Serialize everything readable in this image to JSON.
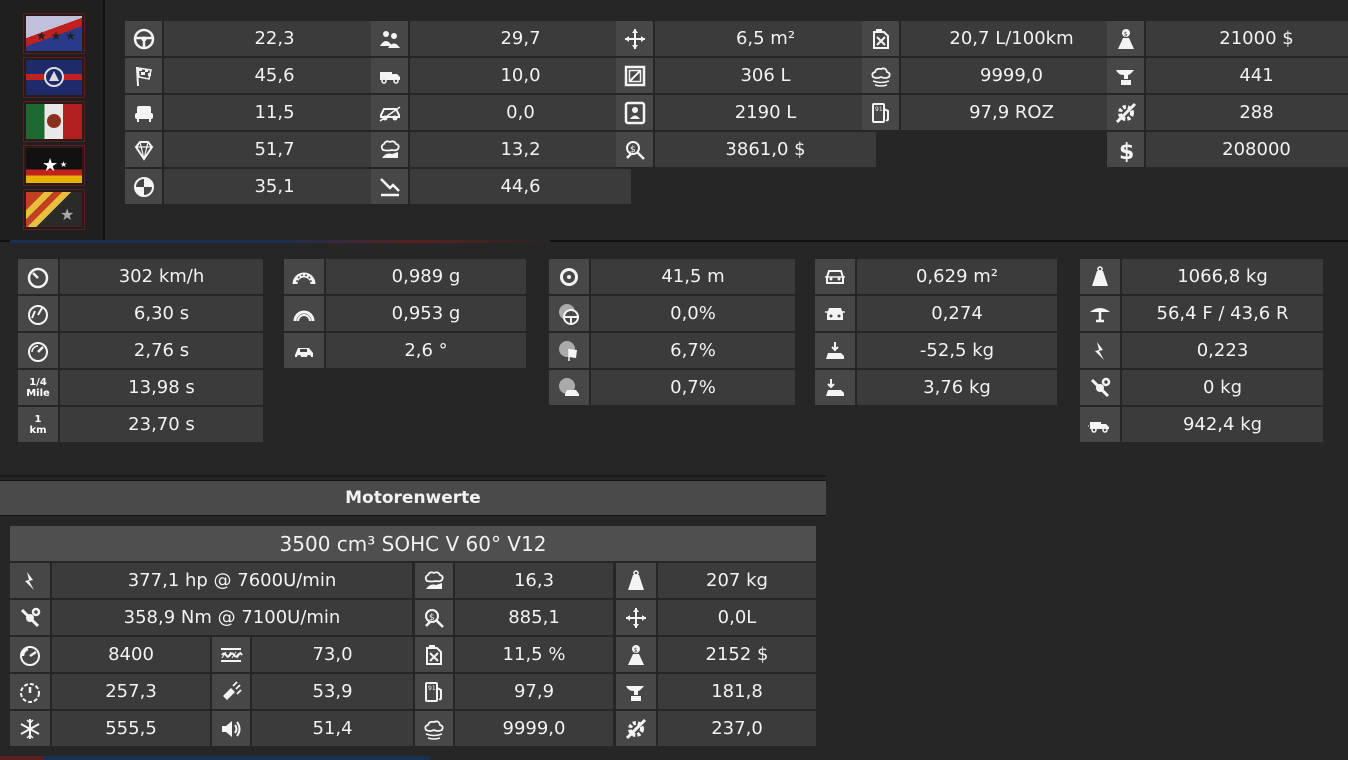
{
  "top_section": {
    "col1": [
      {
        "icon": "steering-wheel-icon",
        "value": "22,3"
      },
      {
        "icon": "checkered-flag-icon",
        "value": "45,6"
      },
      {
        "icon": "seat-icon",
        "value": "11,5"
      },
      {
        "icon": "diamond-icon",
        "value": "51,7"
      },
      {
        "icon": "crash-test-icon",
        "value": "35,1"
      }
    ],
    "col2": [
      {
        "icon": "people-icon",
        "value": "29,7"
      },
      {
        "icon": "truck-icon",
        "value": "10,0"
      },
      {
        "icon": "offroad-car-icon",
        "value": "0,0"
      },
      {
        "icon": "environment-icon",
        "value": "13,2"
      },
      {
        "icon": "trend-down-icon",
        "value": "44,6"
      }
    ],
    "col3": [
      {
        "icon": "move-arrows-icon",
        "value": "6,5 m²"
      },
      {
        "icon": "cargo-box-icon",
        "value": "306 L"
      },
      {
        "icon": "passenger-space-icon",
        "value": "2190 L"
      },
      {
        "icon": "service-cost-icon",
        "value": "3861,0 $"
      }
    ],
    "col4": [
      {
        "icon": "fuel-can-icon",
        "value": "20,7 L/100km"
      },
      {
        "icon": "emissions-cloud-icon",
        "value": "9999,0"
      },
      {
        "icon": "fuel-pump-icon",
        "value": "97,9 ROZ"
      }
    ],
    "col5": [
      {
        "icon": "money-person-icon",
        "value": "21000 $"
      },
      {
        "icon": "anvil-icon",
        "value": "441"
      },
      {
        "icon": "gear-wrench-icon",
        "value": "288"
      },
      {
        "icon": "dollar-icon",
        "value": "208000"
      }
    ]
  },
  "performance_section": {
    "col1": [
      {
        "icon": "speedometer-icon",
        "value": "302 km/h"
      },
      {
        "icon": "acceleration-gauge-icon",
        "value": "6,30 s"
      },
      {
        "icon": "acceleration-gauge-2-icon",
        "value": "2,76 s"
      },
      {
        "icon": "quarter-mile-icon",
        "value": "13,98 s",
        "icon_text": [
          "1/4",
          "Mile"
        ]
      },
      {
        "icon": "one-km-icon",
        "value": "23,70 s",
        "icon_text": [
          "1",
          "km"
        ]
      }
    ],
    "col2": [
      {
        "icon": "tire-grip-icon",
        "value": "0,989 g"
      },
      {
        "icon": "tire-grip-2-icon",
        "value": "0,953 g"
      },
      {
        "icon": "car-roll-icon",
        "value": "2,6 °"
      }
    ],
    "col3": [
      {
        "icon": "brake-disc-icon",
        "value": "41,5 m"
      },
      {
        "icon": "brake-steer-icon",
        "value": "0,0%"
      },
      {
        "icon": "brake-flag-icon",
        "value": "6,7%"
      },
      {
        "icon": "brake-car-icon",
        "value": "0,7%"
      }
    ],
    "col4": [
      {
        "icon": "car-front-icon",
        "value": "0,629 m²"
      },
      {
        "icon": "car-front-2-icon",
        "value": "0,274"
      },
      {
        "icon": "downforce-front-icon",
        "value": "-52,5 kg"
      },
      {
        "icon": "downforce-rear-icon",
        "value": "3,76 kg"
      }
    ],
    "col5": [
      {
        "icon": "weight-icon",
        "value": "1066,8 kg"
      },
      {
        "icon": "weight-distribution-icon",
        "value": "56,4 F / 43,6 R"
      },
      {
        "icon": "power-icon",
        "value": "0,223"
      },
      {
        "icon": "torque-wrench-icon",
        "value": "0 kg"
      },
      {
        "icon": "towing-icon",
        "value": "942,4 kg"
      }
    ]
  },
  "engine": {
    "header": "Motorenwerte",
    "title": "3500 cm³ SOHC V 60° V12",
    "power": {
      "icon": "power-icon",
      "value": "377,1 hp @ 7600U/min"
    },
    "torque": {
      "icon": "torque-wrench-icon",
      "value": "358,9 Nm @ 7100U/min"
    },
    "small_left": [
      {
        "icon": "rpm-gauge-icon",
        "value": "8400"
      },
      {
        "icon": "rpm-gauge-2-icon",
        "value": "257,3"
      },
      {
        "icon": "snowflake-icon",
        "value": "555,5"
      }
    ],
    "small_right": [
      {
        "icon": "heat-icon",
        "value": "73,0"
      },
      {
        "icon": "vibration-icon",
        "value": "53,9"
      },
      {
        "icon": "sound-icon",
        "value": "51,4"
      }
    ],
    "col3": [
      {
        "icon": "environment-icon",
        "value": "16,3"
      },
      {
        "icon": "service-cost-icon",
        "value": "885,1"
      },
      {
        "icon": "fuel-can-icon",
        "value": "11,5 %"
      },
      {
        "icon": "fuel-pump-icon",
        "value": "97,9"
      },
      {
        "icon": "emissions-cloud-icon",
        "value": "9999,0"
      }
    ],
    "col4": [
      {
        "icon": "weight-icon",
        "value": "207 kg"
      },
      {
        "icon": "move-arrows-icon",
        "value": "0,0L"
      },
      {
        "icon": "money-person-icon",
        "value": "2152 $"
      },
      {
        "icon": "anvil-icon",
        "value": "181,8"
      },
      {
        "icon": "gear-wrench-icon",
        "value": "237,0"
      }
    ]
  },
  "flags": [
    {
      "name": "flag-1"
    },
    {
      "name": "flag-2"
    },
    {
      "name": "flag-3"
    },
    {
      "name": "flag-4"
    },
    {
      "name": "flag-5"
    }
  ]
}
